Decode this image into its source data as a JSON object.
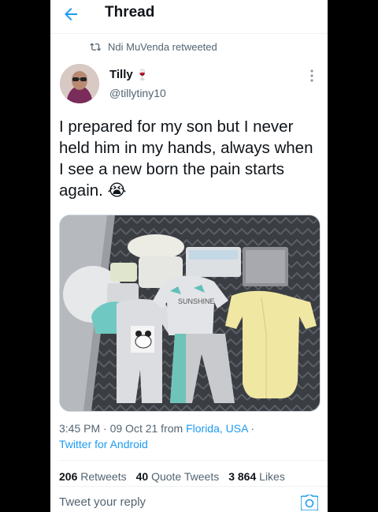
{
  "header": {
    "title": "Thread",
    "back_icon": "back-arrow-icon"
  },
  "retweet": {
    "label": "Ndi MuVenda retweeted",
    "icon": "retweet-icon"
  },
  "author": {
    "name": "Tilly",
    "emoji": "🍷",
    "handle": "@tillytiny10"
  },
  "tweet": {
    "text": "I prepared for my son but I never held him in my hands, always when I see a new born the pain starts again. 😭",
    "media_icon": "baby-clothes-photo"
  },
  "meta": {
    "time": "3:45 PM",
    "sep1": " · ",
    "date": "09 Oct 21",
    "from": " from ",
    "location": "Florida, USA",
    "sep2": " · ",
    "client": "Twitter for Android"
  },
  "stats": {
    "retweets_count": "206",
    "retweets_label": "Retweets",
    "quotes_count": "40",
    "quotes_label": "Quote Tweets",
    "likes_count": "3 864",
    "likes_label": "Likes"
  },
  "reply": {
    "placeholder": "Tweet your reply",
    "camera_icon": "camera-icon"
  },
  "colors": {
    "accent": "#1d9bf0",
    "secondary_text": "#536471",
    "primary_text": "#0f1419"
  }
}
